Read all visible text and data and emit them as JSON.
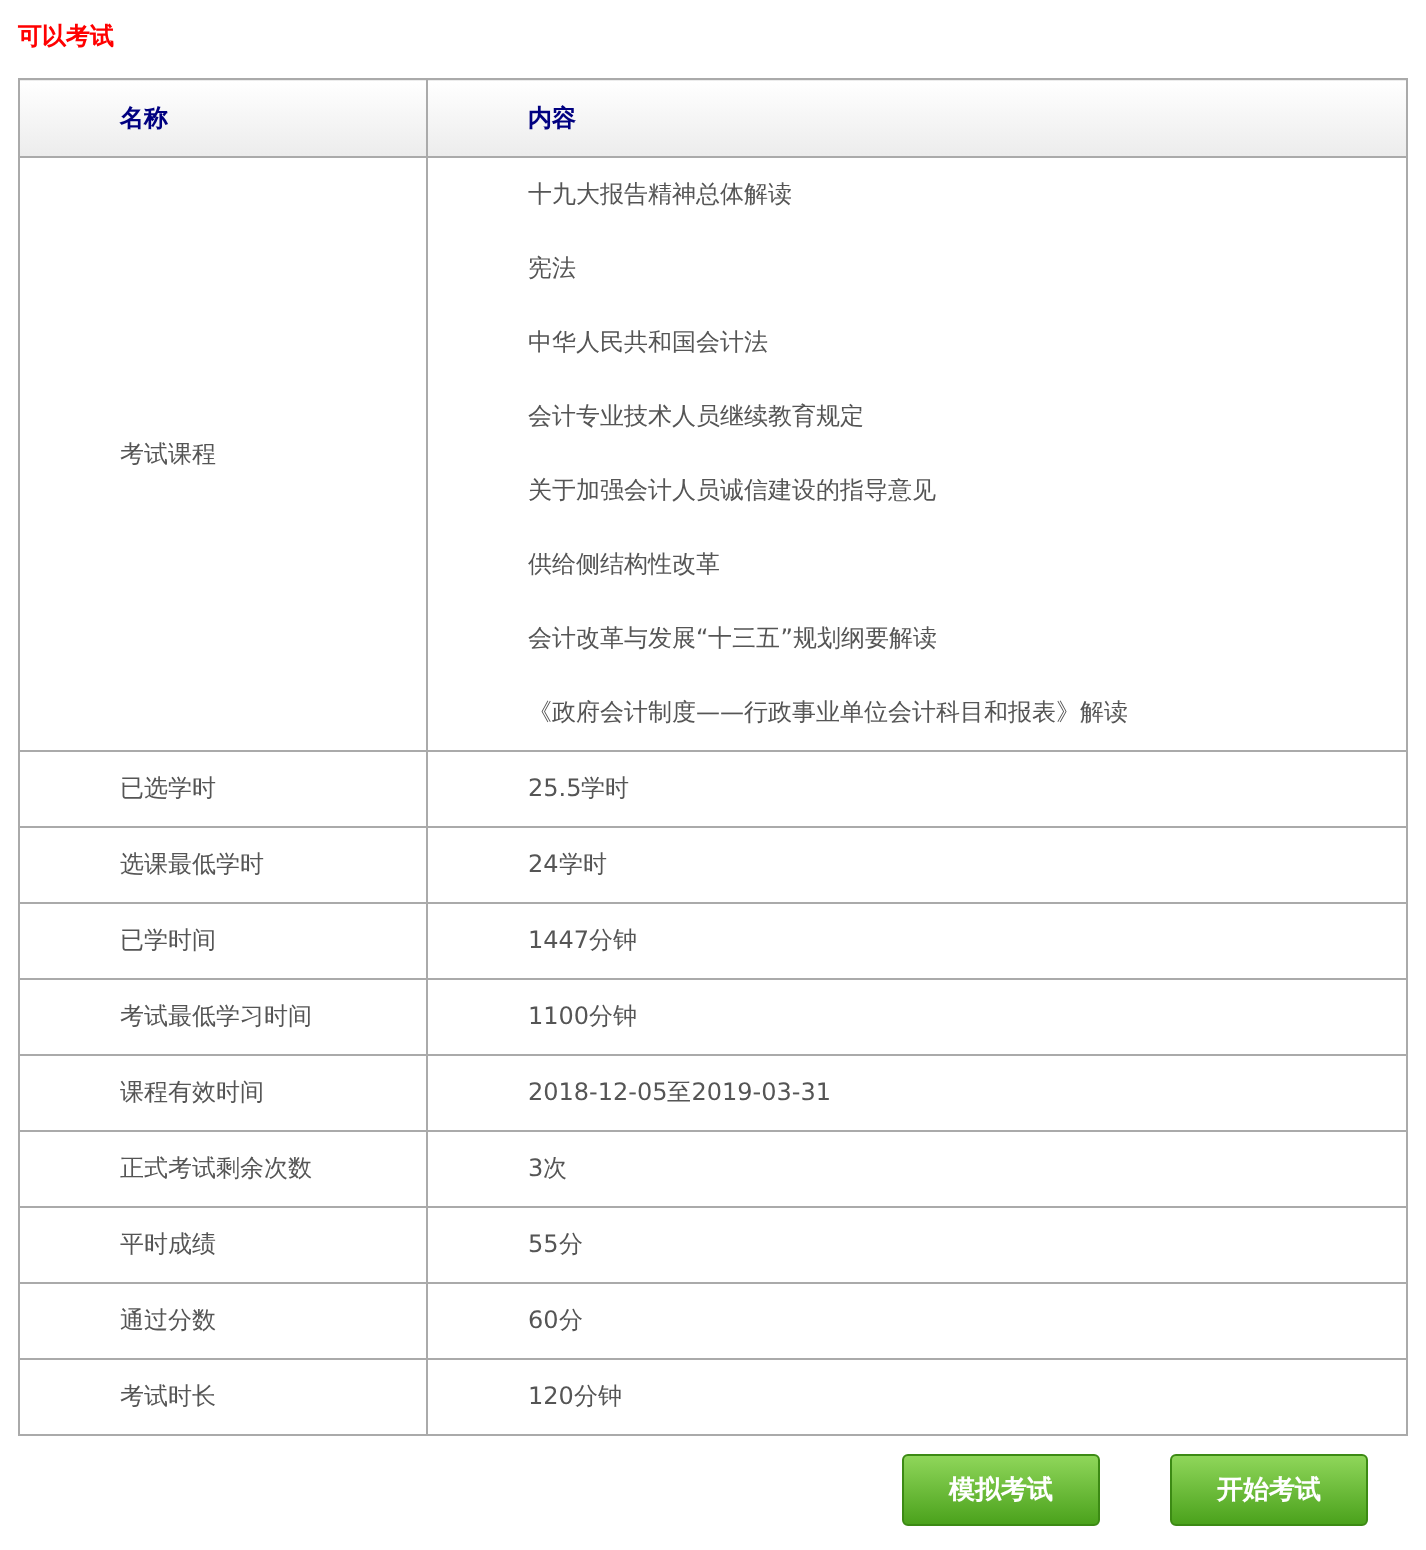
{
  "status": "可以考试",
  "table": {
    "columns": [
      "名称",
      "内容"
    ],
    "courses_row": {
      "label": "考试课程",
      "courses": [
        "十九大报告精神总体解读",
        "宪法",
        "中华人民共和国会计法",
        "会计专业技术人员继续教育规定",
        "关于加强会计人员诚信建设的指导意见",
        "供给侧结构性改革",
        "会计改革与发展“十三五”规划纲要解读",
        "《政府会计制度——行政事业单位会计科目和报表》解读"
      ]
    },
    "rows": [
      {
        "label": "已选学时",
        "value": "25.5学时"
      },
      {
        "label": "选课最低学时",
        "value": "24学时"
      },
      {
        "label": "已学时间",
        "value": "1447分钟"
      },
      {
        "label": "考试最低学习时间",
        "value": "1100分钟"
      },
      {
        "label": "课程有效时间",
        "value": "2018-12-05至2019-03-31"
      },
      {
        "label": "正式考试剩余次数",
        "value": "3次"
      },
      {
        "label": "平时成绩",
        "value": "55分"
      },
      {
        "label": "通过分数",
        "value": "60分"
      },
      {
        "label": "考试时长",
        "value": "120分钟"
      }
    ]
  },
  "buttons": [
    "模拟考试",
    "开始考试"
  ]
}
